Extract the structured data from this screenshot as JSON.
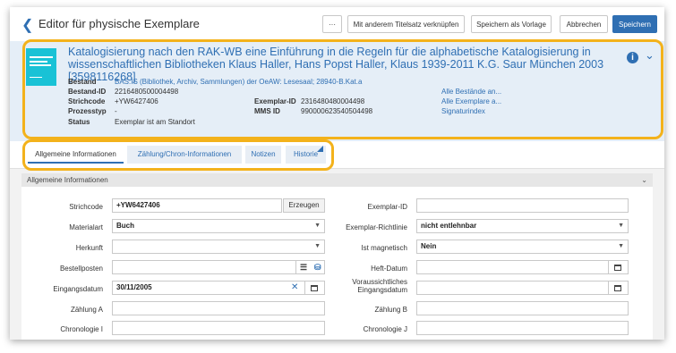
{
  "topbar": {
    "title": "Editor für physische Exemplare",
    "more_label": "···",
    "link_label": "Mit anderem Titelsatz verknüpfen",
    "template_label": "Speichern als Vorlage",
    "cancel_label": "Abbrechen",
    "save_label": "Speichern"
  },
  "record": {
    "title": "Katalogisierung nach den RAK-WB eine Einführung in die Regeln für die alphabetische Katalogisierung in wissenschaftlichen Bibliotheken Klaus Haller, Hans Popst Haller, Klaus 1939-2011 K.G. Saur München 2003 [3598116268]",
    "fields": {
      "bestand_label": "Bestand",
      "bestand_value": "BAS:IS (Bibliothek, Archiv, Sammlungen) der OeAW: Lesesaal; 28940-B.Kat.a",
      "bestand_id_label": "Bestand-ID",
      "bestand_id_value": "2216480500004498",
      "strichcode_label": "Strichcode",
      "strichcode_value": "+YW6427406",
      "prozesstyp_label": "Prozesstyp",
      "prozesstyp_value": "-",
      "status_label": "Status",
      "status_value": "Exemplar ist am Standort",
      "exemplar_id_label": "Exemplar-ID",
      "exemplar_id_value": "2316480480004498",
      "mms_id_label": "MMS ID",
      "mms_id_value": "990000623540504498"
    },
    "links": {
      "all_holdings": "Alle Bestände an...",
      "all_items": "Alle Exemplare a...",
      "signature_index": "Signaturindex"
    }
  },
  "tabs": [
    {
      "label": "Allgemeine Informationen",
      "active": true
    },
    {
      "label": "Zählung/Chron-Informationen",
      "active": false
    },
    {
      "label": "Notizen",
      "active": false
    },
    {
      "label": "Historie",
      "active": false
    }
  ],
  "section": {
    "title": "Allgemeine Informationen"
  },
  "form": {
    "strichcode": {
      "label": "Strichcode",
      "value": "+YW6427406",
      "button": "Erzeugen"
    },
    "materialart": {
      "label": "Materialart",
      "value": "Buch"
    },
    "herkunft": {
      "label": "Herkunft",
      "value": ""
    },
    "bestellposten": {
      "label": "Bestellposten",
      "value": ""
    },
    "eingangsdatum": {
      "label": "Eingangsdatum",
      "value": "30/11/2005"
    },
    "zaehlung_a": {
      "label": "Zählung A",
      "value": ""
    },
    "chronologie_i": {
      "label": "Chronologie I",
      "value": ""
    },
    "exemplar_id": {
      "label": "Exemplar-ID",
      "value": ""
    },
    "richtlinie": {
      "label": "Exemplar-Richtlinie",
      "value": "nicht entlehnbar"
    },
    "magnetisch": {
      "label": "Ist magnetisch",
      "value": "Nein"
    },
    "heft_datum": {
      "label": "Heft-Datum",
      "value": ""
    },
    "vorauss_label_1": "Voraussichtliches",
    "vorauss_label_2": "Eingangsdatum",
    "vorauss_value": "",
    "zaehlung_b": {
      "label": "Zählung B",
      "value": ""
    },
    "chronologie_j": {
      "label": "Chronologie J",
      "value": ""
    }
  },
  "colors": {
    "accent": "#2f6fb3",
    "highlight": "#f3b21b",
    "header_bg": "#e5eef7"
  }
}
